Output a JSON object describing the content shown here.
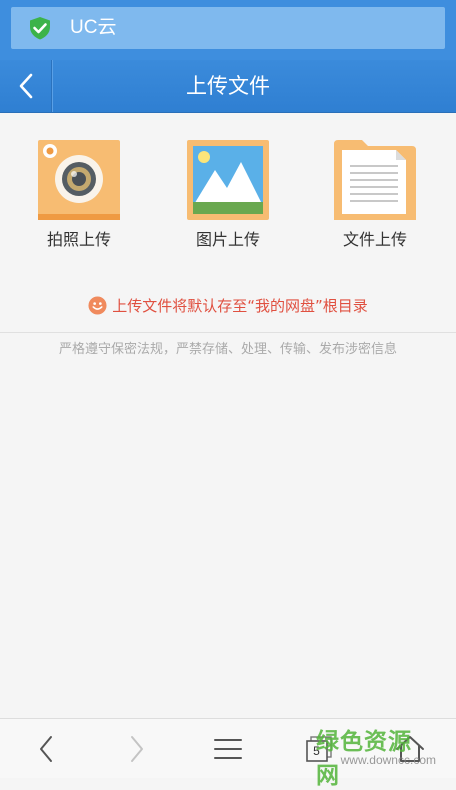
{
  "address_bar": {
    "url_text": "UC云"
  },
  "header": {
    "title": "上传文件"
  },
  "upload_options": [
    {
      "label": "拍照上传",
      "icon": "camera-icon"
    },
    {
      "label": "图片上传",
      "icon": "picture-icon"
    },
    {
      "label": "文件上传",
      "icon": "document-icon"
    }
  ],
  "notice": {
    "text": "上传文件将默认存至“我的网盘”根目录"
  },
  "policy": {
    "text": "严格遵守保密法规，严禁存储、处理、传输、发布涉密信息"
  },
  "toolbar": {
    "tab_count": "5",
    "items": [
      "back-icon",
      "forward-icon",
      "menu-icon",
      "tabs-icon",
      "home-icon"
    ]
  },
  "watermark": {
    "main": "绿色资源网",
    "sub": "www.downcc.com"
  },
  "colors": {
    "header_blue": "#3e8ede",
    "tile_orange": "#f7bc72",
    "notice_red": "#e05040",
    "secure_green": "#3cb34a"
  }
}
